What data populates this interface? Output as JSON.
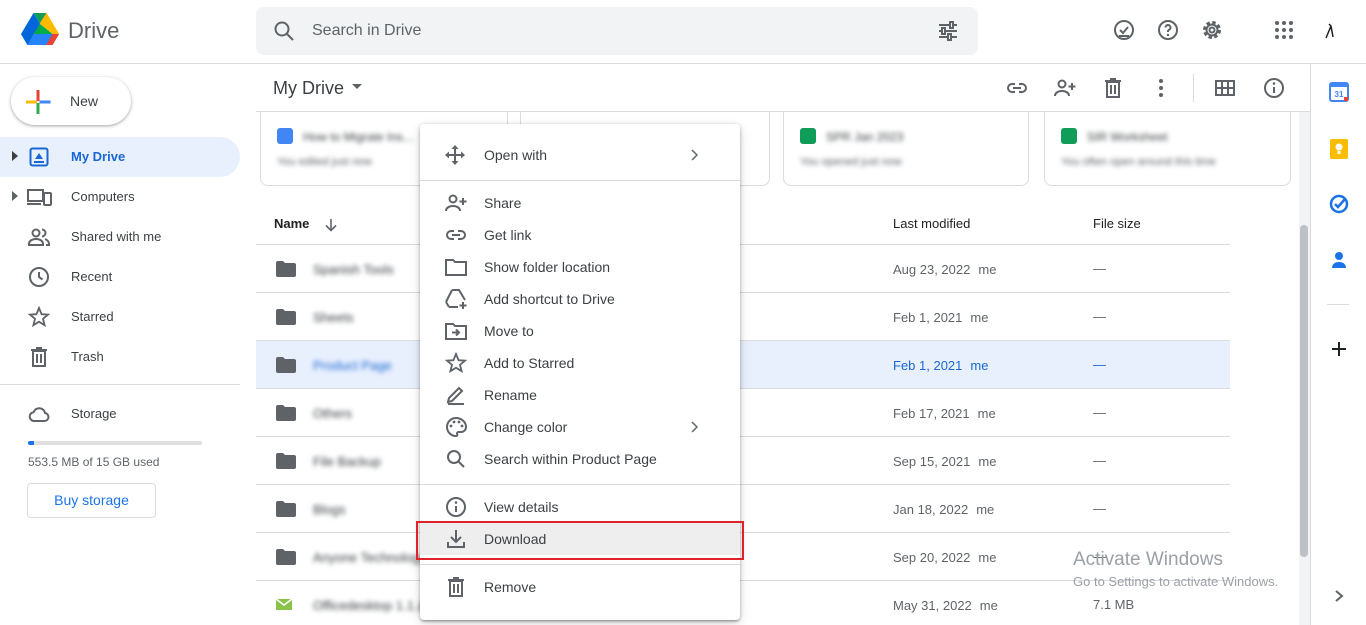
{
  "app": {
    "name": "Drive"
  },
  "search": {
    "placeholder": "Search in Drive"
  },
  "header_icons": [
    "offline-ready-icon",
    "help-icon",
    "settings-icon",
    "apps-grid-icon",
    "account-avatar"
  ],
  "sidebar": {
    "new_label": "New",
    "items": [
      {
        "label": "My Drive",
        "icon": "my-drive-icon",
        "active": true
      },
      {
        "label": "Computers",
        "icon": "computers-icon"
      },
      {
        "label": "Shared with me",
        "icon": "shared-icon"
      },
      {
        "label": "Recent",
        "icon": "clock-icon"
      },
      {
        "label": "Starred",
        "icon": "star-icon"
      },
      {
        "label": "Trash",
        "icon": "trash-icon"
      }
    ],
    "storage": {
      "label": "Storage",
      "used_text": "553.5 MB of 15 GB used",
      "used_fraction": 0.036,
      "buy_label": "Buy storage"
    }
  },
  "main": {
    "title": "My Drive",
    "toolbar_icons": [
      "get-link-icon",
      "share-icon",
      "trash-icon",
      "more-icon",
      "grid-view-icon",
      "info-icon"
    ],
    "suggested": [
      {
        "name": "How to Migrate Ins...",
        "sub": "You edited just now",
        "color": "#4285f4"
      },
      {
        "name": "",
        "sub": "",
        "color": "#ffffff"
      },
      {
        "name": "SPR Jan 2023",
        "sub": "You opened just now",
        "color": "#0f9d58"
      },
      {
        "name": "SIR Worksheet",
        "sub": "You often open around this time",
        "color": "#0f9d58"
      }
    ],
    "columns": {
      "name": "Name",
      "modified": "Last modified",
      "size": "File size"
    },
    "rows": [
      {
        "name": "Spanish Tools",
        "date": "Aug 23, 2022",
        "owner": "me",
        "size": "—",
        "type": "folder"
      },
      {
        "name": "Sheets",
        "date": "Feb 1, 2021",
        "owner": "me",
        "size": "—",
        "type": "folder"
      },
      {
        "name": "Product Page",
        "date": "Feb 1, 2021",
        "owner": "me",
        "size": "—",
        "type": "folder",
        "selected": true
      },
      {
        "name": "Others",
        "date": "Feb 17, 2021",
        "owner": "me",
        "size": "—",
        "type": "folder"
      },
      {
        "name": "File Backup",
        "date": "Sep 15, 2021",
        "owner": "me",
        "size": "—",
        "type": "folder"
      },
      {
        "name": "Blogs",
        "date": "Jan 18, 2022",
        "owner": "me",
        "size": "—",
        "type": "folder"
      },
      {
        "name": "Anyone Technology",
        "date": "Sep 20, 2022",
        "owner": "me",
        "size": "—",
        "type": "folder"
      },
      {
        "name": "Officedesktop 1.1.zip",
        "date": "May 31, 2022",
        "owner": "me",
        "size": "7.1 MB",
        "type": "file"
      }
    ]
  },
  "watermark": {
    "line1": "Activate Windows",
    "line2": "Go to Settings to activate Windows."
  },
  "context_menu": {
    "items": [
      {
        "label": "Open with",
        "icon": "open-with-icon",
        "submenu": true
      },
      {
        "label": "Share",
        "icon": "share-person-icon"
      },
      {
        "label": "Get link",
        "icon": "link-icon"
      },
      {
        "label": "Show folder location",
        "icon": "folder-outline-icon"
      },
      {
        "label": "Add shortcut to Drive",
        "icon": "add-shortcut-icon"
      },
      {
        "label": "Move to",
        "icon": "move-to-icon"
      },
      {
        "label": "Add to Starred",
        "icon": "star-outline-icon"
      },
      {
        "label": "Rename",
        "icon": "pencil-icon"
      },
      {
        "label": "Change color",
        "icon": "palette-icon",
        "submenu": true
      },
      {
        "label": "Search within Product Page",
        "icon": "search-icon"
      },
      {
        "label": "View details",
        "icon": "info-icon"
      },
      {
        "label": "Download",
        "icon": "download-icon",
        "highlighted": true
      },
      {
        "label": "Remove",
        "icon": "trash-icon"
      }
    ]
  },
  "side_panel": [
    "calendar-icon",
    "keep-icon",
    "tasks-icon",
    "contacts-icon",
    "add-icon",
    "expand-chevron-icon"
  ]
}
